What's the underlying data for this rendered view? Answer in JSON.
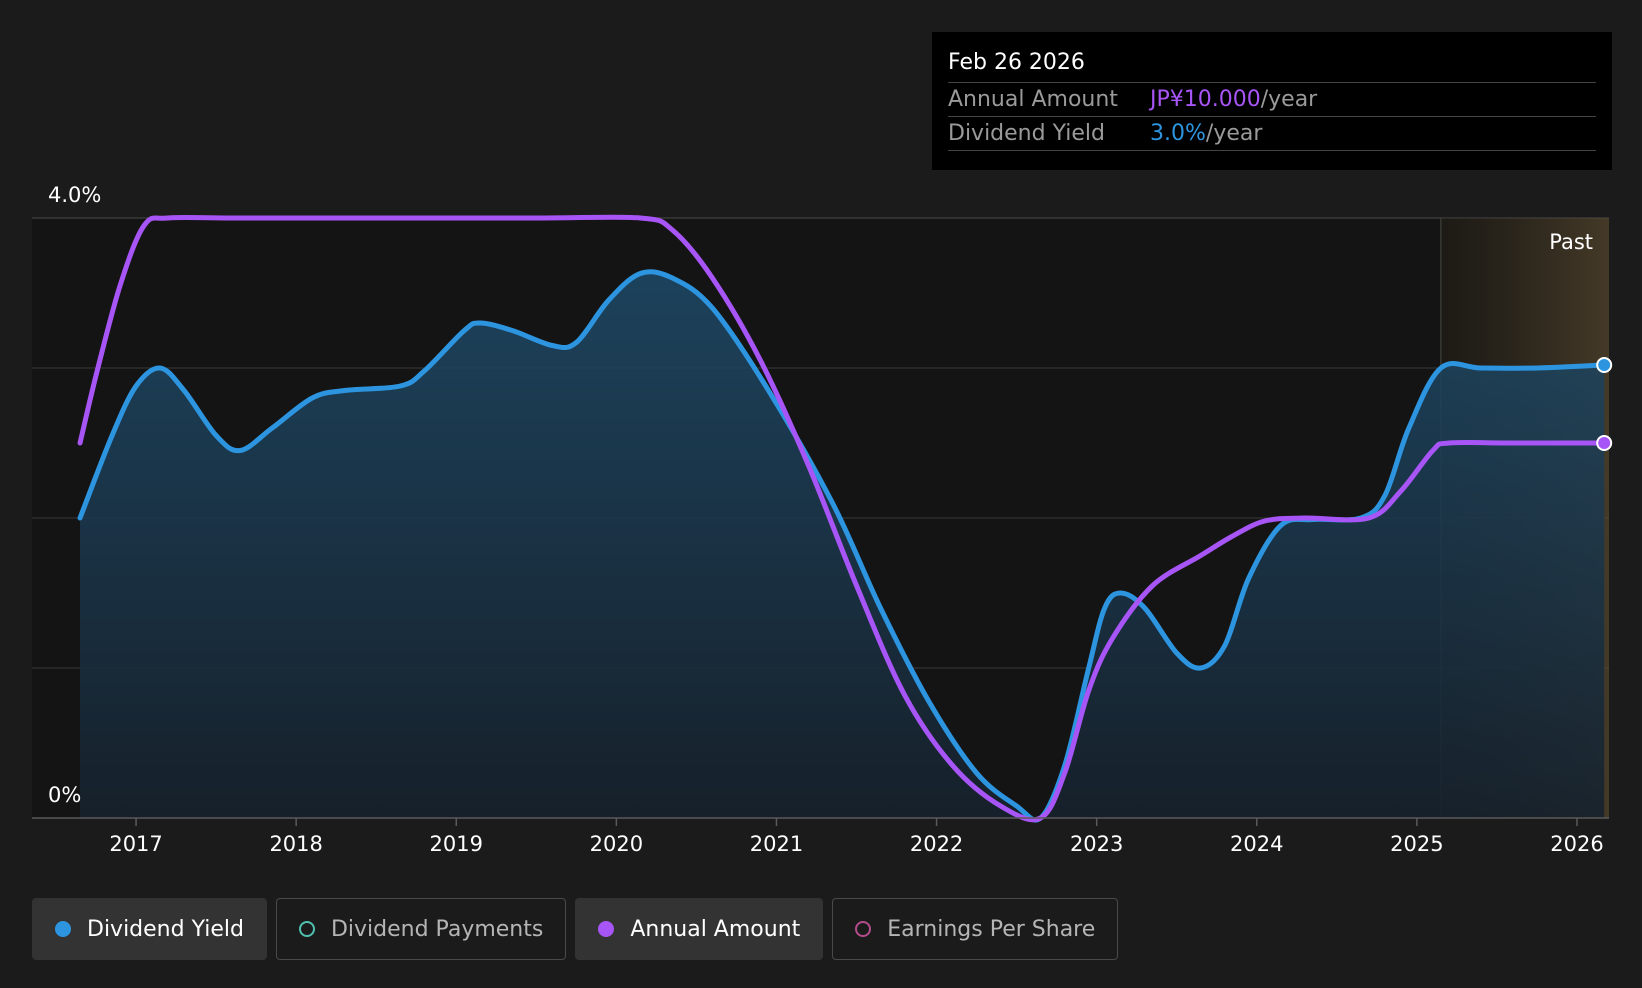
{
  "tooltip": {
    "date": "Feb 26 2026",
    "rows": [
      {
        "label": "Annual Amount",
        "value": "JP¥10.000",
        "suffix": "/year"
      },
      {
        "label": "Dividend Yield",
        "value": "3.0%",
        "suffix": "/year"
      }
    ]
  },
  "past_label": "Past",
  "legend": [
    {
      "label": "Dividend Yield",
      "color": "#2d95e0",
      "active": true
    },
    {
      "label": "Dividend Payments",
      "color": "#4fc1b0",
      "active": false
    },
    {
      "label": "Annual Amount",
      "color": "#a855f7",
      "active": true
    },
    {
      "label": "Earnings Per Share",
      "color": "#b34c8a",
      "active": false
    }
  ],
  "colors": {
    "background": "#1b1b1b",
    "plot_area": "#141414",
    "dividend_yield": "#2d95e0",
    "annual_amount": "#a855f7",
    "gridline": "#3a3a3a"
  },
  "chart_data": {
    "type": "line",
    "title": "",
    "xlabel": "",
    "ylabel": "",
    "x_ticks": [
      "2017",
      "2018",
      "2019",
      "2020",
      "2021",
      "2022",
      "2023",
      "2024",
      "2025",
      "2026"
    ],
    "y_tick_labels": [
      "4.0%",
      "0%"
    ],
    "xlim": [
      2016.35,
      2026.2
    ],
    "ylim": [
      0,
      4.0
    ],
    "y_gridlines": [
      0,
      1,
      2,
      3,
      4
    ],
    "past_region_start": 2025.15,
    "legend_position": "bottom",
    "series": [
      {
        "name": "Dividend Yield",
        "color": "#2d95e0",
        "area_fill": true,
        "points": [
          [
            2016.65,
            2.0
          ],
          [
            2016.85,
            2.55
          ],
          [
            2017.0,
            2.88
          ],
          [
            2017.15,
            3.0
          ],
          [
            2017.3,
            2.85
          ],
          [
            2017.5,
            2.55
          ],
          [
            2017.65,
            2.45
          ],
          [
            2017.85,
            2.6
          ],
          [
            2018.1,
            2.8
          ],
          [
            2018.3,
            2.85
          ],
          [
            2018.65,
            2.88
          ],
          [
            2018.8,
            2.98
          ],
          [
            2019.05,
            3.25
          ],
          [
            2019.15,
            3.3
          ],
          [
            2019.35,
            3.25
          ],
          [
            2019.6,
            3.15
          ],
          [
            2019.75,
            3.17
          ],
          [
            2019.95,
            3.45
          ],
          [
            2020.15,
            3.63
          ],
          [
            2020.35,
            3.6
          ],
          [
            2020.6,
            3.4
          ],
          [
            2020.95,
            2.85
          ],
          [
            2021.35,
            2.1
          ],
          [
            2021.65,
            1.4
          ],
          [
            2021.95,
            0.78
          ],
          [
            2022.25,
            0.3
          ],
          [
            2022.5,
            0.08
          ],
          [
            2022.65,
            0.0
          ],
          [
            2022.8,
            0.35
          ],
          [
            2022.95,
            1.0
          ],
          [
            2023.05,
            1.4
          ],
          [
            2023.15,
            1.5
          ],
          [
            2023.3,
            1.4
          ],
          [
            2023.5,
            1.1
          ],
          [
            2023.65,
            1.0
          ],
          [
            2023.8,
            1.15
          ],
          [
            2023.95,
            1.6
          ],
          [
            2024.15,
            1.95
          ],
          [
            2024.35,
            1.99
          ],
          [
            2024.65,
            2.0
          ],
          [
            2024.8,
            2.15
          ],
          [
            2024.95,
            2.6
          ],
          [
            2025.15,
            3.0
          ],
          [
            2025.4,
            3.0
          ],
          [
            2025.75,
            3.0
          ],
          [
            2026.17,
            3.02
          ]
        ]
      },
      {
        "name": "Annual Amount",
        "color": "#a855f7",
        "area_fill": false,
        "points": [
          [
            2016.65,
            2.5
          ],
          [
            2016.75,
            2.95
          ],
          [
            2016.9,
            3.55
          ],
          [
            2017.05,
            3.95
          ],
          [
            2017.2,
            4.0
          ],
          [
            2017.6,
            4.0
          ],
          [
            2018.5,
            4.0
          ],
          [
            2019.5,
            4.0
          ],
          [
            2020.15,
            4.0
          ],
          [
            2020.35,
            3.92
          ],
          [
            2020.6,
            3.6
          ],
          [
            2020.9,
            3.05
          ],
          [
            2021.2,
            2.35
          ],
          [
            2021.5,
            1.55
          ],
          [
            2021.8,
            0.82
          ],
          [
            2022.1,
            0.35
          ],
          [
            2022.4,
            0.08
          ],
          [
            2022.65,
            0.0
          ],
          [
            2022.8,
            0.3
          ],
          [
            2022.95,
            0.85
          ],
          [
            2023.1,
            1.2
          ],
          [
            2023.35,
            1.55
          ],
          [
            2023.65,
            1.75
          ],
          [
            2023.85,
            1.88
          ],
          [
            2024.05,
            1.98
          ],
          [
            2024.3,
            2.0
          ],
          [
            2024.7,
            2.0
          ],
          [
            2024.9,
            2.18
          ],
          [
            2025.1,
            2.45
          ],
          [
            2025.2,
            2.5
          ],
          [
            2025.6,
            2.5
          ],
          [
            2026.17,
            2.5
          ]
        ]
      }
    ]
  }
}
